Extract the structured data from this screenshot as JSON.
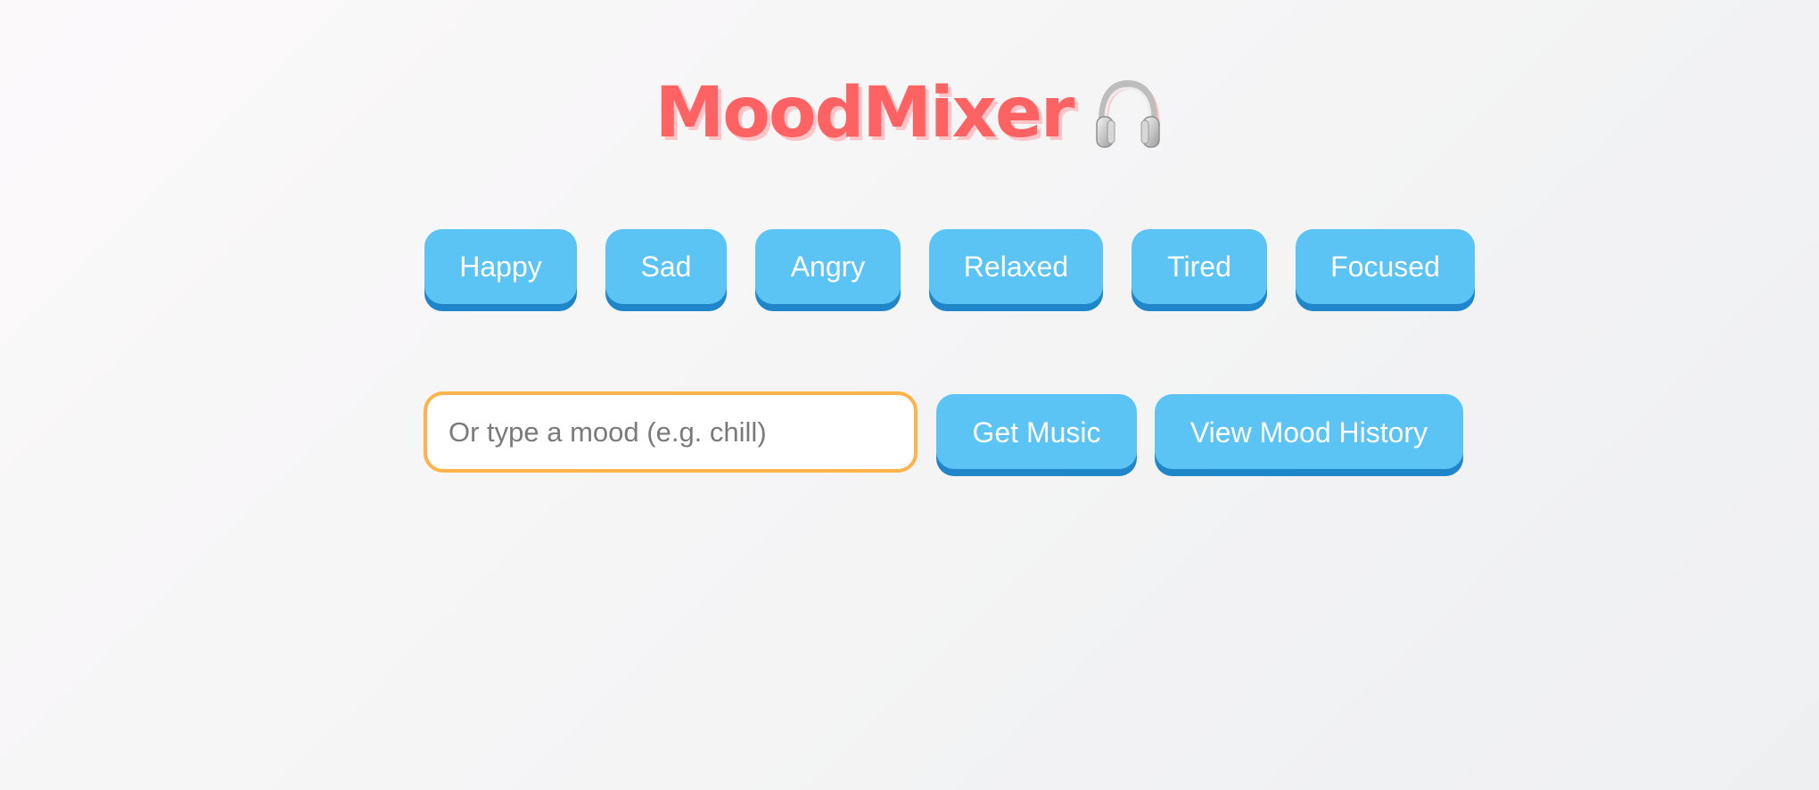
{
  "header": {
    "title": "MoodMixer",
    "icon": "headphones-icon"
  },
  "moods": [
    {
      "label": "Happy"
    },
    {
      "label": "Sad"
    },
    {
      "label": "Angry"
    },
    {
      "label": "Relaxed"
    },
    {
      "label": "Tired"
    },
    {
      "label": "Focused"
    }
  ],
  "search": {
    "value": "",
    "placeholder": "Or type a mood (e.g. chill)"
  },
  "actions": {
    "get_music_label": "Get Music",
    "history_label": "View Mood History"
  },
  "colors": {
    "title": "#ff6262",
    "title_shadow": "#ffc4c8",
    "button": "#5bc4f5",
    "button_shadow": "#1e86c9",
    "input_border": "#ffb34a",
    "background": "#f4f4f5"
  }
}
